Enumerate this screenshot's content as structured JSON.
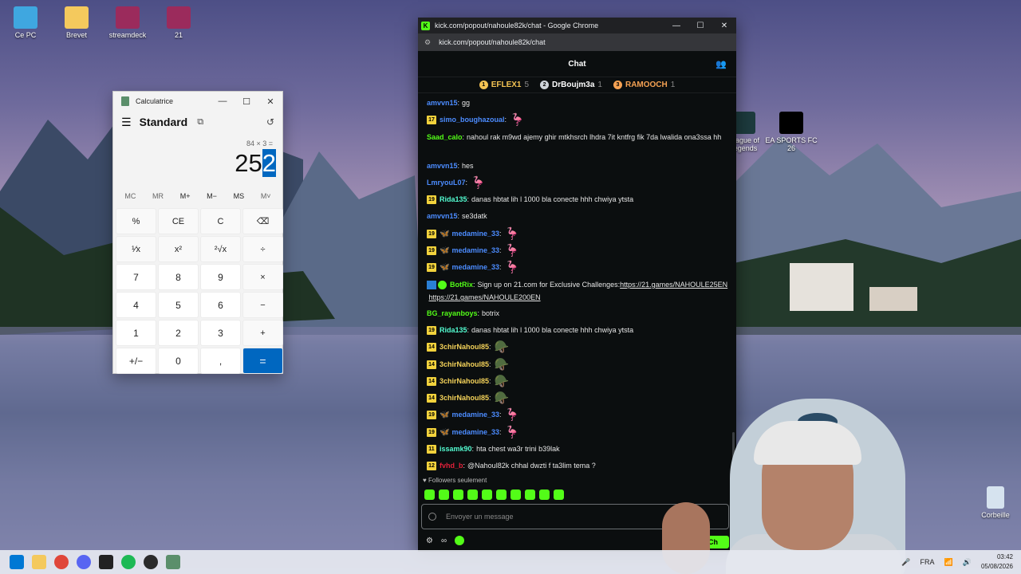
{
  "desktop": {
    "icons": [
      {
        "label": "Ce PC"
      },
      {
        "label": "Brevet"
      },
      {
        "label": "streamdeck"
      },
      {
        "label": "21"
      },
      {
        "label": "League of Legends"
      },
      {
        "label": "EA SPORTS FC 26"
      },
      {
        "label": "Corbeille"
      }
    ]
  },
  "calculator": {
    "title": "Calculatrice",
    "mode": "Standard",
    "expression": "84 × 3 =",
    "display_main": "25",
    "display_selected": "2",
    "memory": [
      "MC",
      "MR",
      "M+",
      "M−",
      "MS",
      "M˅"
    ],
    "keys": [
      "%",
      "CE",
      "C",
      "⌫",
      "¹⁄x",
      "x²",
      "²√x",
      "÷",
      "7",
      "8",
      "9",
      "×",
      "4",
      "5",
      "6",
      "−",
      "1",
      "2",
      "3",
      "+",
      "+/−",
      "0",
      ",",
      "="
    ]
  },
  "browser": {
    "window_title": "kick.com/popout/nahoule82k/chat - Google Chrome",
    "url": "kick.com/popout/nahoule82k/chat",
    "chat_title": "Chat",
    "top_gifters": [
      {
        "rank": "1",
        "name": "EFLEX1",
        "count": "5"
      },
      {
        "rank": "2",
        "name": "DrBoujm3a",
        "count": "1"
      },
      {
        "rank": "3",
        "name": "RAMOOCH",
        "count": "1"
      }
    ],
    "messages": [
      {
        "level": "",
        "user": "amvvn15",
        "color": "#4c8cff",
        "text": "gg",
        "emote": ""
      },
      {
        "level": "17",
        "user": "simo_boughazoual",
        "color": "#4c8cff",
        "text": "",
        "emote": "🦩"
      },
      {
        "level": "",
        "user": "Saad_calo",
        "color": "#53fc18",
        "text": "nahoul rak m9wd ajemy ghir mtkhsrch lhdra 7it kntfrg fik 7da lwalida ona3ssa hh",
        "emote": ""
      },
      {
        "level": "",
        "user": "amvvn15",
        "color": "#4c8cff",
        "text": "hes",
        "emote": ""
      },
      {
        "level": "",
        "user": "LmryouL07",
        "color": "#4c8cff",
        "text": "",
        "emote": "🦩"
      },
      {
        "level": "19",
        "user": "Rida135",
        "color": "#53fcd1",
        "text": "danas hbtat lih l 1000 bla conecte hhh chwiya ytsta",
        "emote": ""
      },
      {
        "level": "",
        "user": "amvvn15",
        "color": "#4c8cff",
        "text": "se3datk",
        "emote": ""
      },
      {
        "level": "19",
        "moth": true,
        "user": "medamine_33",
        "color": "#4c8cff",
        "text": "",
        "emote": "🦩"
      },
      {
        "level": "19",
        "moth": true,
        "user": "medamine_33",
        "color": "#4c8cff",
        "text": "",
        "emote": "🦩"
      },
      {
        "level": "19",
        "moth": true,
        "user": "medamine_33",
        "color": "#4c8cff",
        "text": "",
        "emote": "🦩"
      }
    ],
    "bot_message": {
      "user": "BotRix",
      "text": "Sign up on 21.com for Exclusive Challenges:",
      "link1": "https://21.games/NAHOULE25EN",
      "link2": "https://21.games/NAHOULE200EN"
    },
    "messages2": [
      {
        "level": "",
        "user": "BG_rayanboys",
        "color": "#53fc18",
        "text": "botrix",
        "emote": ""
      },
      {
        "level": "19",
        "user": "Rida135",
        "color": "#53fcd1",
        "text": "danas hbtat lih l 1000 bla conecte hhh chwiya ytsta",
        "emote": ""
      },
      {
        "level": "14",
        "user": "3chirNahoul85",
        "color": "#f5d35a",
        "text": "",
        "emote": "🪖"
      },
      {
        "level": "14",
        "user": "3chirNahoul85",
        "color": "#f5d35a",
        "text": "",
        "emote": "🪖"
      },
      {
        "level": "14",
        "user": "3chirNahoul85",
        "color": "#f5d35a",
        "text": "",
        "emote": "🪖"
      },
      {
        "level": "14",
        "user": "3chirNahoul85",
        "color": "#f5d35a",
        "text": "",
        "emote": "🪖"
      },
      {
        "level": "19",
        "moth": true,
        "user": "medamine_33",
        "color": "#4c8cff",
        "text": "",
        "emote": "🦩"
      },
      {
        "level": "19",
        "moth": true,
        "user": "medamine_33",
        "color": "#4c8cff",
        "text": "",
        "emote": "🦩"
      },
      {
        "level": "11",
        "user": "issamk90",
        "color": "#53fcd1",
        "text": "hta chest wa3r trini b39lak",
        "emote": ""
      },
      {
        "level": "12",
        "user": "fvhd_b",
        "color": "#e0213a",
        "text": "@Nahoul82k chhal dwzti f ta3lim tema ?",
        "emote": ""
      }
    ],
    "followers_only": "Followers seulement",
    "input_placeholder": "Envoyer un message",
    "chat_button": "Ch"
  },
  "taskbar": {
    "language": "FRA",
    "time": "03:42",
    "date": "05/08/2026"
  }
}
